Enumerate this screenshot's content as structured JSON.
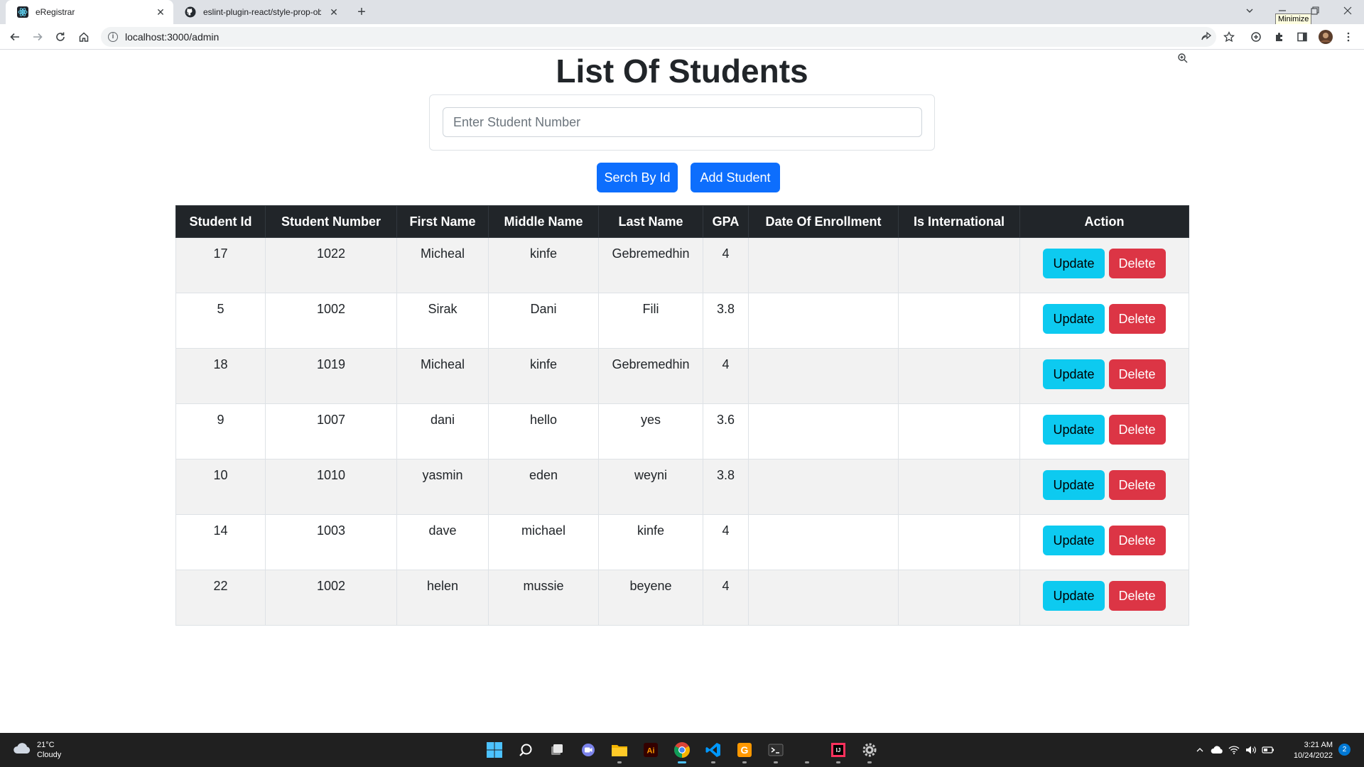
{
  "browser": {
    "tabs": [
      {
        "title": "eRegistrar",
        "active": true,
        "icon": "react-icon"
      },
      {
        "title": "eslint-plugin-react/style-prop-ob",
        "active": false,
        "icon": "github-icon"
      }
    ],
    "new_tab_label": "+",
    "tooltip": "Minimize",
    "url": "localhost:3000/admin"
  },
  "page": {
    "title": "List Of Students",
    "search": {
      "placeholder": "Enter Student Number",
      "value": ""
    },
    "search_button": "Serch By Id",
    "add_button": "Add Student"
  },
  "table": {
    "headers": [
      "Student Id",
      "Student Number",
      "First Name",
      "Middle Name",
      "Last Name",
      "GPA",
      "Date Of Enrollment",
      "Is International",
      "Action"
    ],
    "update_label": "Update",
    "delete_label": "Delete",
    "rows": [
      {
        "id": "17",
        "number": "1022",
        "first": "Micheal",
        "middle": "kinfe",
        "last": "Gebremedhin",
        "gpa": "4",
        "enrollment": "",
        "international": ""
      },
      {
        "id": "5",
        "number": "1002",
        "first": "Sirak",
        "middle": "Dani",
        "last": "Fili",
        "gpa": "3.8",
        "enrollment": "",
        "international": ""
      },
      {
        "id": "18",
        "number": "1019",
        "first": "Micheal",
        "middle": "kinfe",
        "last": "Gebremedhin",
        "gpa": "4",
        "enrollment": "",
        "international": ""
      },
      {
        "id": "9",
        "number": "1007",
        "first": "dani",
        "middle": "hello",
        "last": "yes",
        "gpa": "3.6",
        "enrollment": "",
        "international": ""
      },
      {
        "id": "10",
        "number": "1010",
        "first": "yasmin",
        "middle": "eden",
        "last": "weyni",
        "gpa": "3.8",
        "enrollment": "",
        "international": ""
      },
      {
        "id": "14",
        "number": "1003",
        "first": "dave",
        "middle": "michael",
        "last": "kinfe",
        "gpa": "4",
        "enrollment": "",
        "international": ""
      },
      {
        "id": "22",
        "number": "1002",
        "first": "helen",
        "middle": "mussie",
        "last": "beyene",
        "gpa": "4",
        "enrollment": "",
        "international": ""
      }
    ]
  },
  "taskbar": {
    "weather": {
      "temp": "21°C",
      "condition": "Cloudy"
    },
    "time": "3:21 AM",
    "date": "10/24/2022",
    "notification_count": "2"
  },
  "colors": {
    "primary": "#0d6efd",
    "info": "#0dcaf0",
    "danger": "#dc3545",
    "table_header": "#212529",
    "stripe": "#f2f2f2"
  }
}
